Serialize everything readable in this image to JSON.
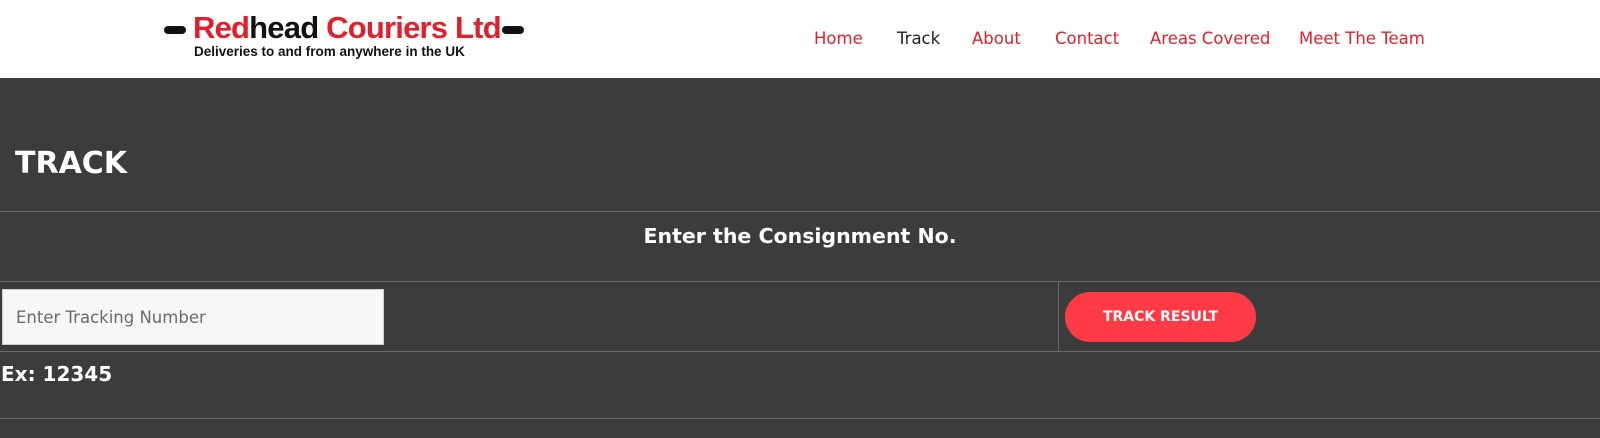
{
  "brand": {
    "logo_red_part": "Red",
    "logo_black_part": "head",
    "logo_red_part2": " Couriers Ltd",
    "tagline": "Deliveries to and from anywhere in the UK"
  },
  "nav": {
    "items": [
      {
        "label": "Home",
        "active": false
      },
      {
        "label": "Track",
        "active": true
      },
      {
        "label": "About",
        "active": false
      },
      {
        "label": "Contact",
        "active": false
      },
      {
        "label": "Areas Covered",
        "active": false
      },
      {
        "label": "Meet The Team",
        "active": false
      }
    ]
  },
  "page": {
    "title": "TRACK"
  },
  "tracking": {
    "caption": "Enter the Consignment No.",
    "input_placeholder": "Enter Tracking Number",
    "input_value": "",
    "button_label": "TRACK RESULT",
    "example": "Ex: 12345"
  },
  "colors": {
    "accent_red": "#e2202b",
    "button_red": "#fd3a46",
    "background_dark": "#3c3c3c",
    "header_bg": "#ffffff"
  }
}
